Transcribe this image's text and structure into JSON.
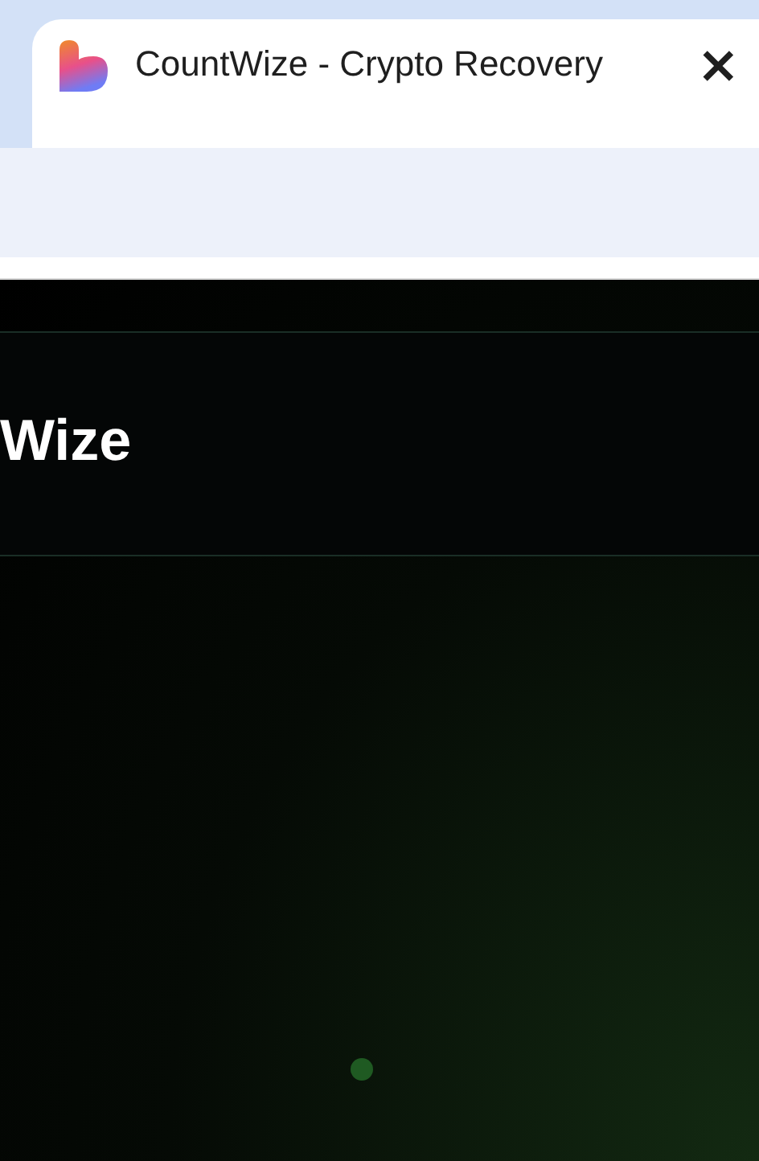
{
  "tab": {
    "title": "CountWize - Crypto Recovery",
    "close": "×"
  },
  "page": {
    "heading": "Wize"
  }
}
